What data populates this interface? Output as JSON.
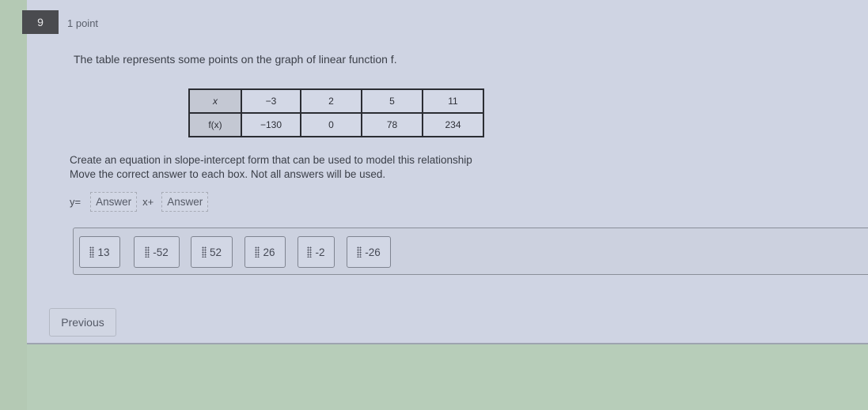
{
  "question": {
    "number": "9",
    "points": "1 point",
    "prompt": "The table represents some points on the graph of linear function f."
  },
  "table": {
    "rows": [
      {
        "header": "x",
        "values": [
          "−3",
          "2",
          "5",
          "11"
        ]
      },
      {
        "header": "f(x)",
        "values": [
          "−130",
          "0",
          "78",
          "234"
        ]
      }
    ]
  },
  "instructions": {
    "line1": "Create an equation in slope-intercept form that can be used to model this relationship",
    "line2": "Move the correct answer to each box.  Not all answers will be used."
  },
  "equation": {
    "prefix": "y=",
    "middle": "x+",
    "slot1_placeholder": "Answer",
    "slot2_placeholder": "Answer"
  },
  "answer_bank": [
    {
      "label": "13",
      "icon": "drag-grip-icon"
    },
    {
      "label": "-52",
      "icon": "drag-grip-icon"
    },
    {
      "label": "52",
      "icon": "drag-grip-icon"
    },
    {
      "label": "26",
      "icon": "drag-grip-icon"
    },
    {
      "label": "-2",
      "icon": "drag-grip-icon"
    },
    {
      "label": "-26",
      "icon": "drag-grip-icon"
    }
  ],
  "navigation": {
    "previous_label": "Previous"
  }
}
